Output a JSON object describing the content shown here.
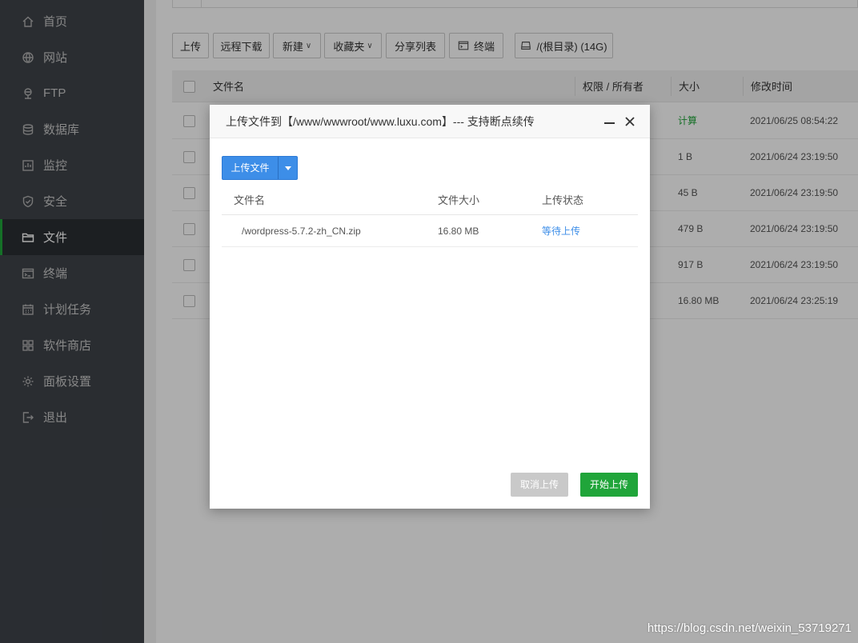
{
  "sidebar": {
    "items": [
      {
        "label": "首页",
        "icon": "home-icon"
      },
      {
        "label": "网站",
        "icon": "globe-icon"
      },
      {
        "label": "FTP",
        "icon": "ftp-icon"
      },
      {
        "label": "数据库",
        "icon": "database-icon"
      },
      {
        "label": "监控",
        "icon": "monitor-icon"
      },
      {
        "label": "安全",
        "icon": "shield-icon"
      },
      {
        "label": "文件",
        "icon": "folder-icon",
        "active": true
      },
      {
        "label": "终端",
        "icon": "terminal-icon"
      },
      {
        "label": "计划任务",
        "icon": "calendar-icon"
      },
      {
        "label": "软件商店",
        "icon": "grid-icon"
      },
      {
        "label": "面板设置",
        "icon": "gear-icon"
      },
      {
        "label": "退出",
        "icon": "logout-icon"
      }
    ]
  },
  "toolbar": {
    "upload": "上传",
    "remote_download": "远程下载",
    "new": "新建",
    "favorites": "收藏夹",
    "share_list": "分享列表",
    "terminal": "终端",
    "disk": "/(根目录) (14G)"
  },
  "file_table": {
    "headers": {
      "name": "文件名",
      "perm": "权限 / 所有者",
      "size": "大小",
      "mtime": "修改时间"
    },
    "rows": [
      {
        "size": "计算",
        "mtime": "2021/06/25 08:54:22"
      },
      {
        "size": "1 B",
        "mtime": "2021/06/24 23:19:50"
      },
      {
        "size": "45 B",
        "mtime": "2021/06/24 23:19:50"
      },
      {
        "size": "479 B",
        "mtime": "2021/06/24 23:19:50"
      },
      {
        "size": "917 B",
        "mtime": "2021/06/24 23:19:50"
      },
      {
        "size": "16.80 MB",
        "mtime": "2021/06/24 23:25:19"
      }
    ]
  },
  "dialog": {
    "title": "上传文件到【/www/wwwroot/www.luxu.com】--- 支持断点续传",
    "upload_button": "上传文件",
    "headers": {
      "name": "文件名",
      "size": "文件大小",
      "status": "上传状态"
    },
    "files": [
      {
        "name": "/wordpress-5.7.2-zh_CN.zip",
        "size": "16.80 MB",
        "status": "等待上传"
      }
    ],
    "cancel": "取消上传",
    "start": "开始上传"
  },
  "watermark": "https://blog.csdn.net/weixin_53719271",
  "colors": {
    "accent": "#20a53a",
    "primary": "#3d8ee8",
    "sidebar": "#3e4349"
  }
}
